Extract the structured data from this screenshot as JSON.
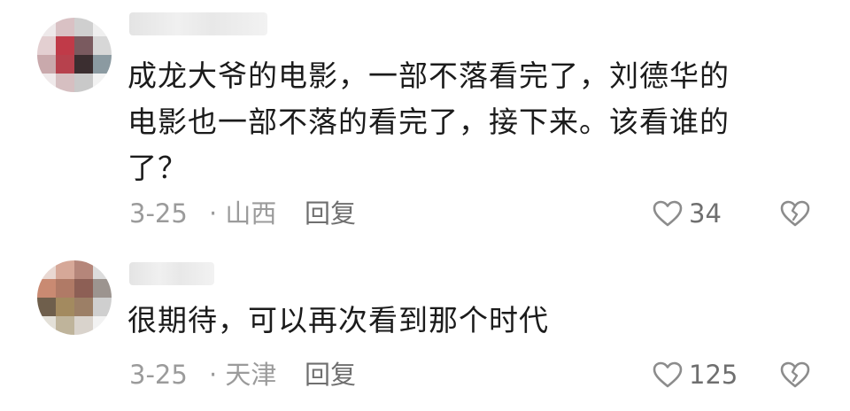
{
  "comments": [
    {
      "text": "成龙大爷的电影，一部不落看完了，刘德华的\n电影也一部不落的看完了，接下来。该看谁的\n了？",
      "date": "3-25",
      "location": "· 山西",
      "reply_label": "回复",
      "likes": "34",
      "avatar_colors": [
        "#eee9ea",
        "#d9c1c4",
        "#cfcfcf",
        "#efefef",
        "#e3cfd1",
        "#c03a48",
        "#7a5a5f",
        "#d7d7d7",
        "#c9a9ac",
        "#b7414d",
        "#3b2e30",
        "#8b9aa1",
        "#efe9ea",
        "#d6bfc1",
        "#c9c9c9",
        "#f2f2f2"
      ]
    },
    {
      "text": "很期待，可以再次看到那个时代",
      "date": "3-25",
      "location": "· 天津",
      "reply_label": "回复",
      "likes": "125",
      "avatar_colors": [
        "#e9d8d2",
        "#d6a898",
        "#b5867a",
        "#dcdcdc",
        "#c98a72",
        "#b07a66",
        "#8d5f55",
        "#9c948f",
        "#6f5f4c",
        "#a38a5f",
        "#9c7f66",
        "#cfcfcf",
        "#e3e0d8",
        "#bfb49b",
        "#d9d3cc",
        "#f2f2f2"
      ]
    }
  ],
  "colors": {
    "meta": "#9b9b9b",
    "reply": "#6f6f6f",
    "icon": "#8c8c8c"
  }
}
